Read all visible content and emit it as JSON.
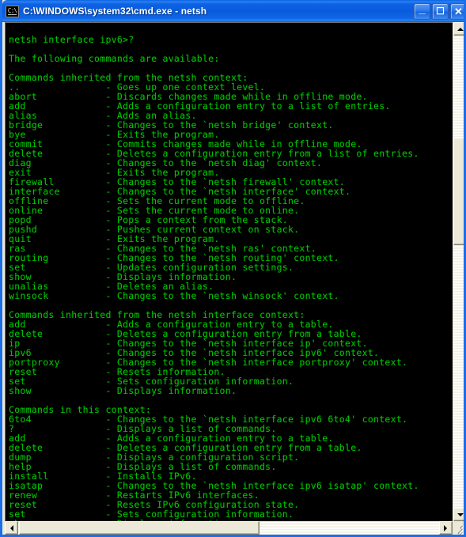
{
  "window": {
    "title": "C:\\WINDOWS\\system32\\cmd.exe - netsh",
    "icon_glyph": "C:\\",
    "titlebar_color": "#0a5bdc",
    "minimize_label": "_",
    "maximize_label": "☐",
    "close_label": "✕"
  },
  "console": {
    "foreground_color": "#00c400",
    "background_color": "#000000",
    "prompt_line": "netsh interface ipv6>?",
    "intro_line": "The following commands are available:",
    "sections": [
      {
        "heading": "Commands inherited from the netsh context:",
        "commands": [
          {
            "name": "..",
            "description": "Goes up one context level."
          },
          {
            "name": "abort",
            "description": "Discards changes made while in offline mode."
          },
          {
            "name": "add",
            "description": "Adds a configuration entry to a list of entries."
          },
          {
            "name": "alias",
            "description": "Adds an alias."
          },
          {
            "name": "bridge",
            "description": "Changes to the `netsh bridge' context."
          },
          {
            "name": "bye",
            "description": "Exits the program."
          },
          {
            "name": "commit",
            "description": "Commits changes made while in offline mode."
          },
          {
            "name": "delete",
            "description": "Deletes a configuration entry from a list of entries."
          },
          {
            "name": "diag",
            "description": "Changes to the `netsh diag' context."
          },
          {
            "name": "exit",
            "description": "Exits the program."
          },
          {
            "name": "firewall",
            "description": "Changes to the `netsh firewall' context."
          },
          {
            "name": "interface",
            "description": "Changes to the `netsh interface' context."
          },
          {
            "name": "offline",
            "description": "Sets the current mode to offline."
          },
          {
            "name": "online",
            "description": "Sets the current mode to online."
          },
          {
            "name": "popd",
            "description": "Pops a context from the stack."
          },
          {
            "name": "pushd",
            "description": "Pushes current context on stack."
          },
          {
            "name": "quit",
            "description": "Exits the program."
          },
          {
            "name": "ras",
            "description": "Changes to the `netsh ras' context."
          },
          {
            "name": "routing",
            "description": "Changes to the `netsh routing' context."
          },
          {
            "name": "set",
            "description": "Updates configuration settings."
          },
          {
            "name": "show",
            "description": "Displays information."
          },
          {
            "name": "unalias",
            "description": "Deletes an alias."
          },
          {
            "name": "winsock",
            "description": "Changes to the `netsh winsock' context."
          }
        ]
      },
      {
        "heading": "Commands inherited from the netsh interface context:",
        "commands": [
          {
            "name": "add",
            "description": "Adds a configuration entry to a table."
          },
          {
            "name": "delete",
            "description": "Deletes a configuration entry from a table."
          },
          {
            "name": "ip",
            "description": "Changes to the `netsh interface ip' context."
          },
          {
            "name": "ipv6",
            "description": "Changes to the `netsh interface ipv6' context."
          },
          {
            "name": "portproxy",
            "description": "Changes to the `netsh interface portproxy' context."
          },
          {
            "name": "reset",
            "description": "Resets information."
          },
          {
            "name": "set",
            "description": "Sets configuration information."
          },
          {
            "name": "show",
            "description": "Displays information."
          }
        ]
      },
      {
        "heading": "Commands in this context:",
        "commands": [
          {
            "name": "6to4",
            "description": "Changes to the `netsh interface ipv6 6to4' context."
          },
          {
            "name": "?",
            "description": "Displays a list of commands."
          },
          {
            "name": "add",
            "description": "Adds a configuration entry to a table."
          },
          {
            "name": "delete",
            "description": "Deletes a configuration entry from a table."
          },
          {
            "name": "dump",
            "description": "Displays a configuration script."
          },
          {
            "name": "help",
            "description": "Displays a list of commands."
          },
          {
            "name": "install",
            "description": "Installs IPv6."
          },
          {
            "name": "isatap",
            "description": "Changes to the `netsh interface ipv6 isatap' context."
          },
          {
            "name": "renew",
            "description": "Restarts IPv6 interfaces."
          },
          {
            "name": "reset",
            "description": "Resets IPv6 configuration state."
          },
          {
            "name": "set",
            "description": "Sets configuration information."
          },
          {
            "name": "show",
            "description": "Displays information."
          }
        ]
      }
    ],
    "name_column_width": 17,
    "separator": "- "
  },
  "scrollbars": {
    "vertical": {
      "up_arrow": "▲",
      "down_arrow": "▼"
    },
    "horizontal": {
      "left_arrow": "◀",
      "right_arrow": "▶"
    }
  }
}
